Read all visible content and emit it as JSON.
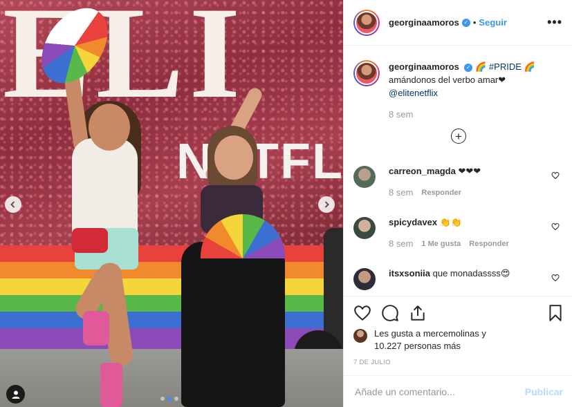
{
  "post": {
    "username": "georginaamoros",
    "follow_label": "Seguir",
    "separator": "•",
    "more_label": "•••",
    "verified_mark": "✓",
    "photo_text": {
      "letters": "ELI",
      "brand": "NETFL"
    },
    "carousel": {
      "count": 3,
      "active_index": 1
    }
  },
  "caption": {
    "username": "georginaamoros",
    "prefix_emoji": "🌈",
    "hashtag": "#PRIDE",
    "suffix_emoji": "🌈",
    "line2": "amándonos del verbo amar❤",
    "mention": "@elitenetflix",
    "time": "8 sem"
  },
  "load_more_label": "+",
  "comments": [
    {
      "user": "carreon_magda",
      "text": "❤❤❤",
      "time": "8 sem",
      "likes": "",
      "reply": "Responder"
    },
    {
      "user": "spicydavex",
      "text": "👏👏",
      "time": "8 sem",
      "likes": "1 Me gusta",
      "reply": "Responder"
    },
    {
      "user": "itsxsoniia",
      "text": "que monadassss😍",
      "time": "",
      "likes": "",
      "reply": ""
    }
  ],
  "likes": {
    "line1": "Les gusta a mercemolinas y",
    "line2": "10.227 personas más"
  },
  "date": "7 DE JULIO",
  "add_comment": {
    "placeholder": "Añade un comentario...",
    "publish_label": "Publicar"
  },
  "colors": {
    "link_blue": "#3897f0",
    "mention_dark_blue": "#003569",
    "publish_disabled": "#b3dbff",
    "muted": "#999999"
  },
  "icons": [
    "heart-icon",
    "comment-icon",
    "share-icon",
    "bookmark-icon",
    "more-options-icon",
    "verified-badge-icon",
    "user-tag-icon",
    "chevron-left-icon",
    "chevron-right-icon",
    "plus-circle-icon"
  ]
}
